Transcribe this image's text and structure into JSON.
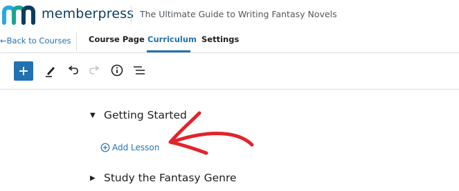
{
  "header": {
    "brand": "memberpress",
    "course_title": "The Ultimate Guide to Writing Fantasy Novels",
    "logo_icon": "memberpress-logo-icon",
    "brand_color": "#0d3b5e",
    "accent_color": "#2271b1"
  },
  "nav": {
    "back_label": "←Back to Courses",
    "tabs": [
      {
        "label": "Course Page",
        "active": false
      },
      {
        "label": "Curriculum",
        "active": true
      },
      {
        "label": "Settings",
        "active": false
      }
    ]
  },
  "toolbar": {
    "icons": [
      "plus-icon",
      "pencil-icon",
      "undo-icon",
      "redo-icon",
      "info-icon",
      "list-view-icon"
    ]
  },
  "curriculum": {
    "sections": [
      {
        "title": "Getting Started",
        "expanded": true
      },
      {
        "title": "Study the Fantasy Genre",
        "expanded": false
      }
    ],
    "add_lesson_label": "Add Lesson",
    "annotation_color": "#e3232c"
  }
}
